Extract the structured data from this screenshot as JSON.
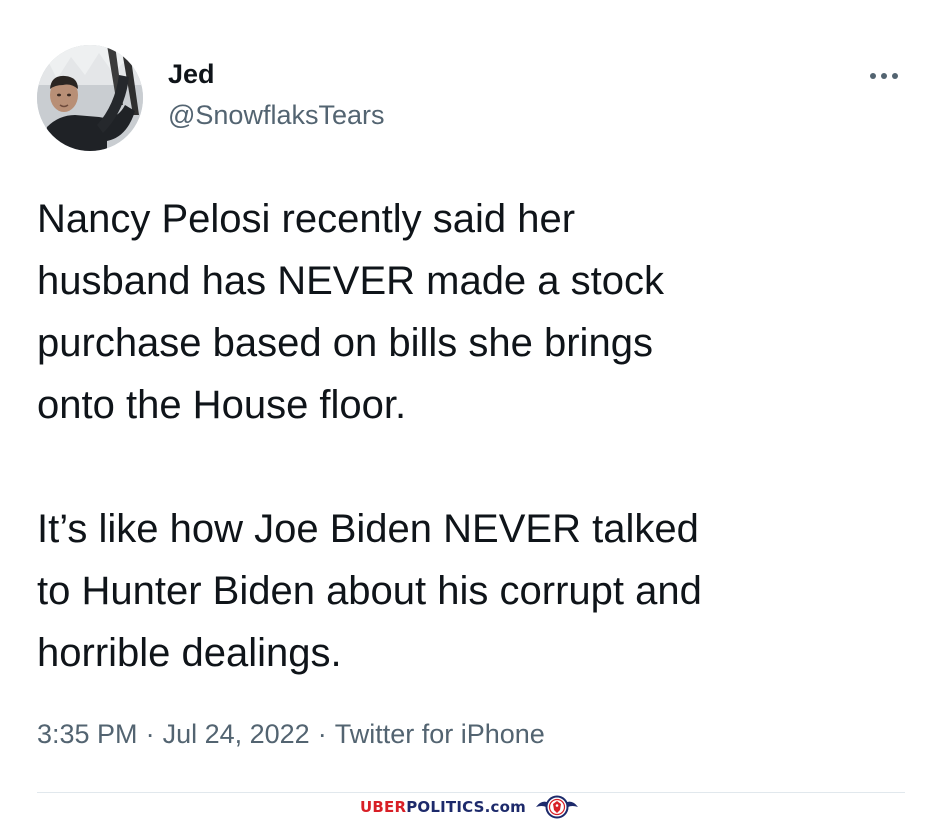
{
  "author": {
    "display_name": "Jed",
    "handle": "@SnowflaksTears",
    "avatar_icon": "profile-photo"
  },
  "tweet": {
    "paragraphs": [
      "Nancy Pelosi recently said her\nhusband has NEVER made a stock\npurchase based on bills she brings\nonto the House floor.",
      "It’s like how Joe Biden NEVER talked\nto Hunter Biden about his corrupt and\nhorrible dealings."
    ],
    "time": "3:35 PM",
    "separator": "·",
    "date": "Jul 24, 2022",
    "source": "Twitter for iPhone"
  },
  "more_icon": "more-horizontal-icon",
  "watermark": {
    "part1": "UBER",
    "part2": "POLITICS.com",
    "seal_icon": "eagle-seal"
  },
  "colors": {
    "text": "#0f1419",
    "secondary": "#536471",
    "divider": "#e1e8ed",
    "watermark_red": "#d81f26",
    "watermark_blue": "#1d2a6b"
  }
}
